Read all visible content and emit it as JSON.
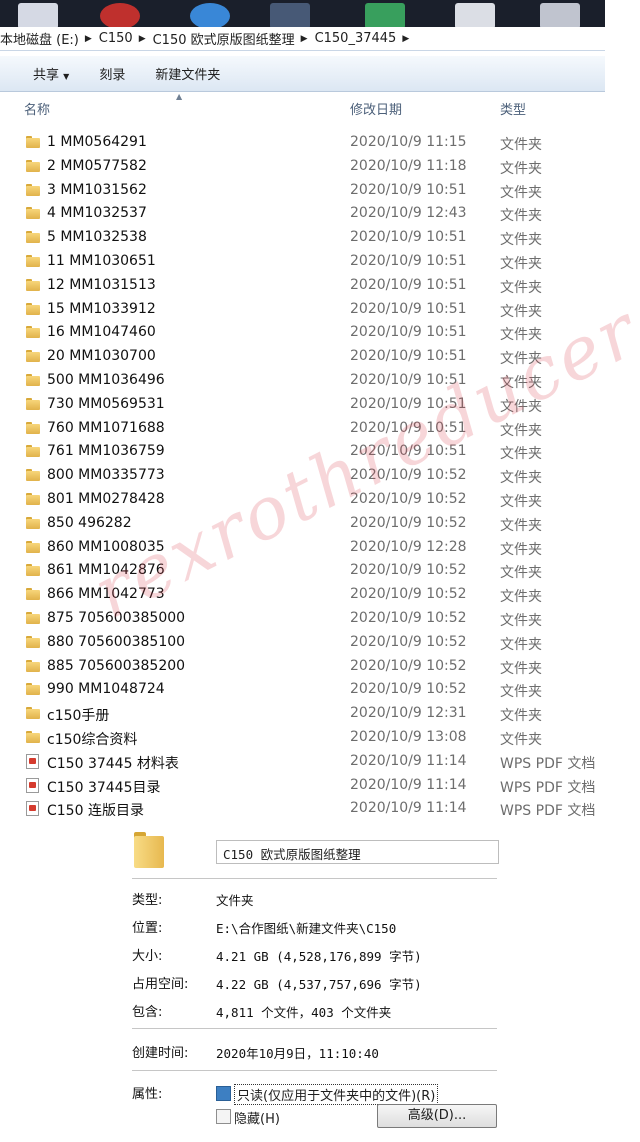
{
  "breadcrumb": [
    "本地磁盘 (E:)",
    "C150",
    "C150 欧式原版图纸整理",
    "C150_37445"
  ],
  "toolbar": {
    "share": "共享",
    "burn": "刻录",
    "new_folder": "新建文件夹"
  },
  "columns": {
    "name": "名称",
    "date": "修改日期",
    "type": "类型"
  },
  "files": [
    {
      "name": "1  MM0564291",
      "date": "2020/10/9 11:15",
      "type": "文件夹",
      "kind": "folder"
    },
    {
      "name": "2  MM0577582",
      "date": "2020/10/9 11:18",
      "type": "文件夹",
      "kind": "folder"
    },
    {
      "name": "3  MM1031562",
      "date": "2020/10/9 10:51",
      "type": "文件夹",
      "kind": "folder"
    },
    {
      "name": "4  MM1032537",
      "date": "2020/10/9 12:43",
      "type": "文件夹",
      "kind": "folder"
    },
    {
      "name": "5  MM1032538",
      "date": "2020/10/9 10:51",
      "type": "文件夹",
      "kind": "folder"
    },
    {
      "name": "11  MM1030651",
      "date": "2020/10/9 10:51",
      "type": "文件夹",
      "kind": "folder"
    },
    {
      "name": "12  MM1031513",
      "date": "2020/10/9 10:51",
      "type": "文件夹",
      "kind": "folder"
    },
    {
      "name": "15  MM1033912",
      "date": "2020/10/9 10:51",
      "type": "文件夹",
      "kind": "folder"
    },
    {
      "name": "16  MM1047460",
      "date": "2020/10/9 10:51",
      "type": "文件夹",
      "kind": "folder"
    },
    {
      "name": "20  MM1030700",
      "date": "2020/10/9 10:51",
      "type": "文件夹",
      "kind": "folder"
    },
    {
      "name": "500  MM1036496",
      "date": "2020/10/9 10:51",
      "type": "文件夹",
      "kind": "folder"
    },
    {
      "name": "730  MM0569531",
      "date": "2020/10/9 10:51",
      "type": "文件夹",
      "kind": "folder"
    },
    {
      "name": "760  MM1071688",
      "date": "2020/10/9 10:51",
      "type": "文件夹",
      "kind": "folder"
    },
    {
      "name": "761  MM1036759",
      "date": "2020/10/9 10:51",
      "type": "文件夹",
      "kind": "folder"
    },
    {
      "name": "800  MM0335773",
      "date": "2020/10/9 10:52",
      "type": "文件夹",
      "kind": "folder"
    },
    {
      "name": "801  MM0278428",
      "date": "2020/10/9 10:52",
      "type": "文件夹",
      "kind": "folder"
    },
    {
      "name": "850  496282",
      "date": "2020/10/9 10:52",
      "type": "文件夹",
      "kind": "folder"
    },
    {
      "name": "860  MM1008035",
      "date": "2020/10/9 12:28",
      "type": "文件夹",
      "kind": "folder"
    },
    {
      "name": "861  MM1042876",
      "date": "2020/10/9 10:52",
      "type": "文件夹",
      "kind": "folder"
    },
    {
      "name": "866  MM1042773",
      "date": "2020/10/9 10:52",
      "type": "文件夹",
      "kind": "folder"
    },
    {
      "name": "875  705600385000",
      "date": "2020/10/9 10:52",
      "type": "文件夹",
      "kind": "folder"
    },
    {
      "name": "880  705600385100",
      "date": "2020/10/9 10:52",
      "type": "文件夹",
      "kind": "folder"
    },
    {
      "name": "885  705600385200",
      "date": "2020/10/9 10:52",
      "type": "文件夹",
      "kind": "folder"
    },
    {
      "name": "990  MM1048724",
      "date": "2020/10/9 10:52",
      "type": "文件夹",
      "kind": "folder"
    },
    {
      "name": "c150手册",
      "date": "2020/10/9 12:31",
      "type": "文件夹",
      "kind": "folder"
    },
    {
      "name": "c150综合资料",
      "date": "2020/10/9 13:08",
      "type": "文件夹",
      "kind": "folder"
    },
    {
      "name": "C150 37445 材料表",
      "date": "2020/10/9 11:14",
      "type": "WPS PDF 文档",
      "kind": "pdf"
    },
    {
      "name": "C150 37445目录",
      "date": "2020/10/9 11:14",
      "type": "WPS PDF 文档",
      "kind": "pdf"
    },
    {
      "name": "C150 连版目录",
      "date": "2020/10/9 11:14",
      "type": "WPS PDF 文档",
      "kind": "pdf"
    }
  ],
  "watermark": "rexrothreducer",
  "properties": {
    "folder_name": "C150 欧式原版图纸整理",
    "type_label": "类型:",
    "type_value": "文件夹",
    "location_label": "位置:",
    "location_value": "E:\\合作图纸\\新建文件夹\\C150",
    "size_label": "大小:",
    "size_value": "4.21 GB (4,528,176,899 字节)",
    "disk_label": "占用空间:",
    "disk_value": "4.22 GB (4,537,757,696 字节)",
    "contains_label": "包含:",
    "contains_value": "4,811 个文件，403 个文件夹",
    "created_label": "创建时间:",
    "created_value": "2020年10月9日，11:10:40",
    "attributes_label": "属性:",
    "readonly_label": "只读(仅应用于文件夹中的文件)(R)",
    "hidden_label": "隐藏(H)",
    "advanced_label": "高级(D)..."
  },
  "colors": {
    "accent": "#3d7fc2",
    "watermark": "#dc4650",
    "folder": "#f0c45e"
  }
}
